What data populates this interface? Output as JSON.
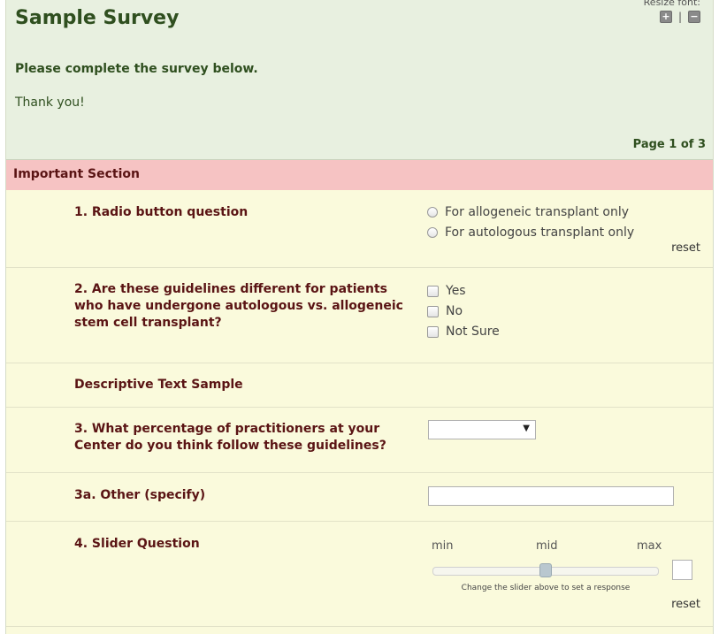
{
  "header": {
    "title": "Sample Survey",
    "resize_font_label": "Resize font:",
    "increase_symbol": "+",
    "decrease_symbol": "−",
    "separator": "|",
    "instructions": "Please complete the survey below.",
    "thanks": "Thank you!",
    "page_indicator": "Page 1 of 3"
  },
  "section": {
    "title": "Important Section"
  },
  "questions": {
    "q1": {
      "label": "1. Radio button question",
      "options": [
        "For allogeneic transplant only",
        "For autologous transplant only"
      ],
      "reset_label": "reset"
    },
    "q2": {
      "label": "2. Are these guidelines different for patients who have undergone autologous vs. allogeneic stem cell transplant?",
      "options": [
        "Yes",
        "No",
        "Not Sure"
      ]
    },
    "descriptive": {
      "label": "Descriptive Text Sample"
    },
    "q3": {
      "label": "3. What percentage of practitioners at your Center do you think follow these guidelines?",
      "selected_value": "",
      "arrow": "▼"
    },
    "q3a": {
      "label": "3a. Other (specify)",
      "value": ""
    },
    "q4": {
      "label": "4. Slider Question",
      "min_label": "min",
      "mid_label": "mid",
      "max_label": "max",
      "slider_position_percent": 50,
      "value": "",
      "help_text": "Change the slider above to set a response",
      "reset_label": "reset"
    }
  },
  "colors": {
    "header_bg": "#e8f0e0",
    "section_bg": "#f6c3c3",
    "row_bg": "#fafadc",
    "title_color": "#2f4f1f",
    "question_color": "#5a1414"
  }
}
